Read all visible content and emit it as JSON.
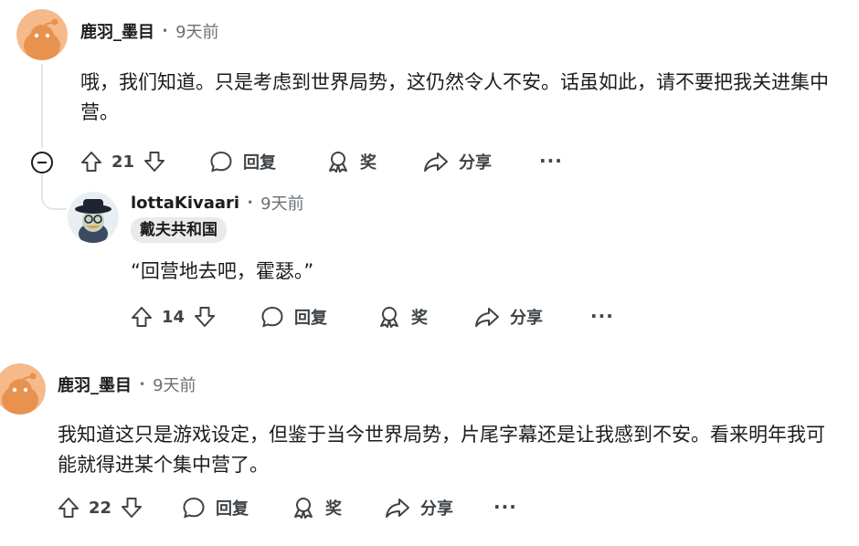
{
  "comments": [
    {
      "author": "鹿羽_墨目",
      "time": "9天前",
      "body": "哦，我们知道。只是考虑到世界局势，这仍然令人不安。话虽如此，请不要把我关进集中营。",
      "votes": "21",
      "reply_label": "回复",
      "award_label": "奖",
      "share_label": "分享",
      "more_label": "···",
      "avatar_color": "#f0a36a"
    },
    {
      "author": "lottaKivaari",
      "time": "9天前",
      "flair": "戴夫共和国",
      "body": "“回营地去吧，霍瑟。”",
      "votes": "14",
      "reply_label": "回复",
      "award_label": "奖",
      "share_label": "分享",
      "more_label": "···"
    },
    {
      "author": "鹿羽_墨目",
      "time": "9天前",
      "body": "我知道这只是游戏设定，但鉴于当今世界局势，片尾字幕还是让我感到不安。看来明年我可能就得进某个集中营了。",
      "votes": "22",
      "reply_label": "回复",
      "award_label": "奖",
      "share_label": "分享",
      "more_label": "···",
      "avatar_color": "#f0a36a"
    }
  ],
  "separator": "•",
  "icons": {
    "upvote": "arrow-up-icon",
    "downvote": "arrow-down-icon",
    "reply": "speech-bubble-icon",
    "award": "award-ribbon-icon",
    "share": "share-arrow-icon",
    "collapse": "minus-circle-icon"
  }
}
